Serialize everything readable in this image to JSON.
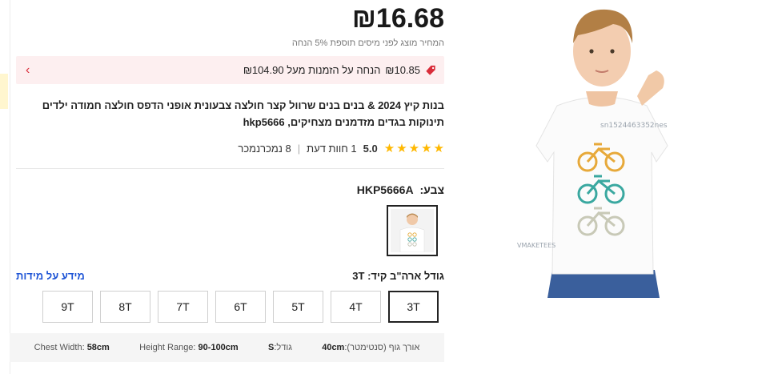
{
  "product": {
    "price": "₪16.68",
    "tax_note": "המחיר מוצג לפני מיסים תוספת 5% הנחה",
    "promo": {
      "discount": "₪10.85",
      "text": "הנחה על הזמנות מעל ₪104.90"
    },
    "title": "בנות קיץ 2024 & בנים בנים שרוול קצר חולצה צבעונית אופני הדפס חולצה חמודה ילדים תינוקות בגדים מזדמנים מצחיקים, hkp5666",
    "rating": {
      "value": "5.0",
      "stars": 5,
      "reviews": "1 חוות דעת",
      "sold": "8 נמכרנמכר"
    },
    "color": {
      "label": "צבע:",
      "value": "HKP5666A"
    },
    "size": {
      "label": "גודל ארה\"ב קיד: 3T",
      "guide": "מידע על מידות",
      "options": [
        "3T",
        "4T",
        "5T",
        "6T",
        "7T",
        "8T",
        "9T"
      ],
      "selected": "3T"
    },
    "measurements": {
      "length_label": "אורך גוף (סנטימטר):",
      "length_value": "40cm",
      "size_label": "גודל:",
      "size_value": "S",
      "height_label": "Height Range:",
      "height_value": "90-100cm",
      "chest_label": "Chest Width:",
      "chest_value": "58cm"
    }
  },
  "image": {
    "watermark_id": "sn1524463352nes",
    "brand_watermark": "VMAKETEES"
  },
  "icons": {
    "promo_icon": "tag-icon",
    "promo_arrow": "chevron-left-icon"
  },
  "colors": {
    "promo_bg": "#fdeff0",
    "promo_accent": "#d92d3a",
    "star": "#ffb800",
    "link": "#1f55d6"
  }
}
